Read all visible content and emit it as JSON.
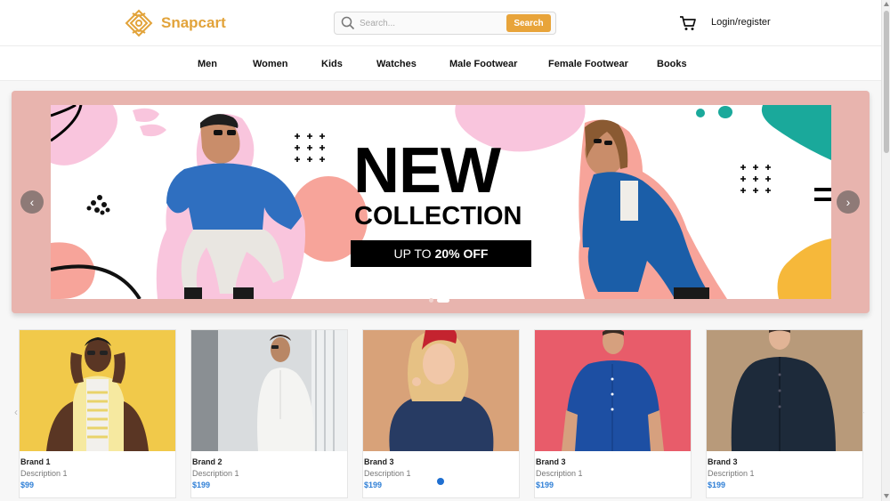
{
  "header": {
    "brand_name": "Snapcart",
    "search_placeholder": "Search...",
    "search_button": "Search",
    "login_label": "Login/register",
    "icons": [
      "logo-icon",
      "search-icon",
      "cart-icon"
    ]
  },
  "nav": {
    "categories": [
      "Men",
      "Women",
      "Kids",
      "Watches",
      "Male Footwear",
      "Female Footwear",
      "Books"
    ]
  },
  "hero": {
    "headline": "NEW",
    "subheadline": "COLLECTION",
    "offer_prefix": "UP TO",
    "offer_value": "20% OFF",
    "prev_icon": "chevron-left-icon",
    "next_icon": "chevron-right-icon",
    "slide_count": 2,
    "active_slide": 2
  },
  "products": [
    {
      "brand": "Brand 1",
      "description": "Description 1",
      "price": "$99",
      "bg": "#f1c94a"
    },
    {
      "brand": "Brand 2",
      "description": "Description 1",
      "price": "$199",
      "bg": "#d9dcde"
    },
    {
      "brand": "Brand 3",
      "description": "Description 1",
      "price": "$199",
      "bg": "#d8a279"
    },
    {
      "brand": "Brand 3",
      "description": "Description 1",
      "price": "$199",
      "bg": "#e85c6a"
    },
    {
      "brand": "Brand 3",
      "description": "Description 1",
      "price": "$199",
      "bg": "#b89a7a"
    }
  ],
  "colors": {
    "accent": "#e8a43a",
    "hero_frame": "#e8b4ae",
    "price": "#2f7fd6"
  }
}
